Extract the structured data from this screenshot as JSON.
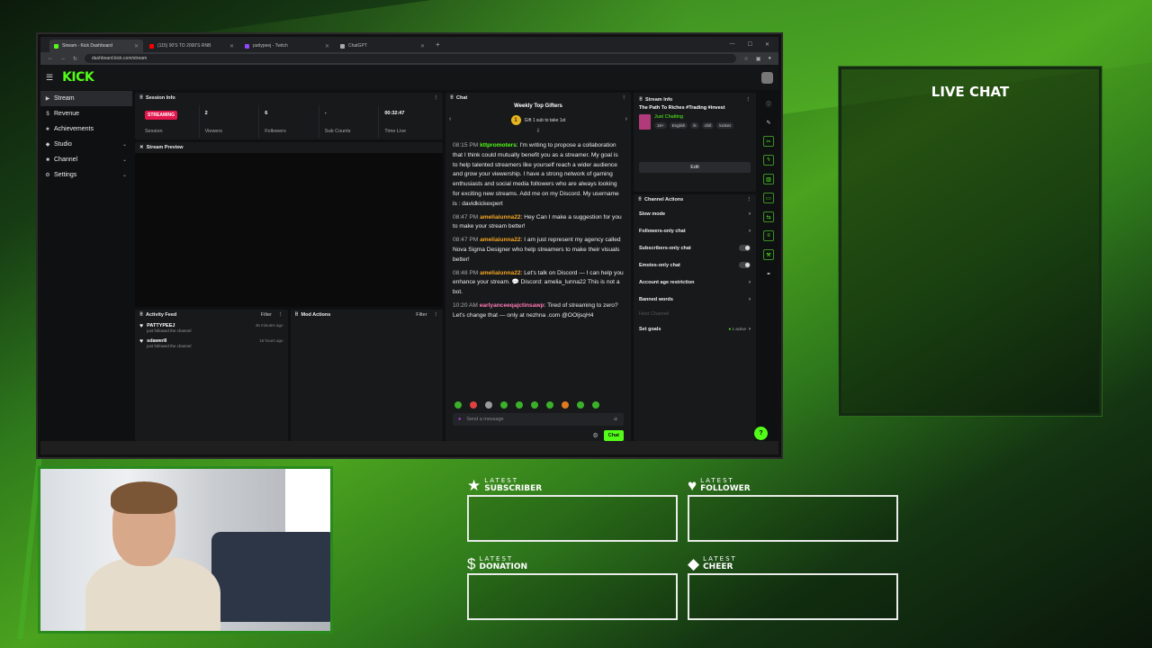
{
  "browser": {
    "tabs": [
      {
        "title": "Stream - Kick Dashboard",
        "color": "#53fc18",
        "active": true
      },
      {
        "title": "(115) 90'S TO 2000'S RNB",
        "color": "#ff0000",
        "active": false
      },
      {
        "title": "pattypeej - Twitch",
        "color": "#9146ff",
        "active": false
      },
      {
        "title": "ChatGPT",
        "color": "#aaaaaa",
        "active": false
      }
    ],
    "new_tab": "+",
    "url": "dashboard.kick.com/stream"
  },
  "kick": {
    "logo": "KICK",
    "sidebar": [
      {
        "label": "Stream",
        "icon": "▶",
        "active": true,
        "chevron": false
      },
      {
        "label": "Revenue",
        "icon": "$",
        "active": false,
        "chevron": false
      },
      {
        "label": "Achievements",
        "icon": "★",
        "active": false,
        "chevron": false
      },
      {
        "label": "Studio",
        "icon": "◆",
        "active": false,
        "chevron": true
      },
      {
        "label": "Channel",
        "icon": "■",
        "active": false,
        "chevron": true
      },
      {
        "label": "Settings",
        "icon": "⚙",
        "active": false,
        "chevron": true
      }
    ],
    "session": {
      "title": "Session Info",
      "badge": "STREAMING",
      "stats": [
        {
          "value": "",
          "label": "Session"
        },
        {
          "value": "2",
          "label": "Viewers"
        },
        {
          "value": "6",
          "label": "Followers"
        },
        {
          "value": "-",
          "label": "Sub Counts"
        },
        {
          "value": "00:32:47",
          "label": "Time Live"
        }
      ]
    },
    "preview": {
      "title": "Stream Preview"
    },
    "activity": {
      "title": "Activity Feed",
      "filter": "Filter",
      "items": [
        {
          "name": "PATTYPEEJ",
          "sub": "just followed the channel",
          "time": "46 minutes ago"
        },
        {
          "name": "sdawer8",
          "sub": "just followed the channel",
          "time": "15 hours ago"
        }
      ]
    },
    "mod": {
      "title": "Mod Actions",
      "filter": "Filter"
    },
    "chat": {
      "title": "Chat",
      "gifters_title": "Weekly Top Gifters",
      "gifters_rank": "1",
      "gifters_text": "Gift 1 sub to take 1st",
      "messages": [
        {
          "time": "08:15 PM",
          "user": "kttpromoters",
          "color": "#53fc18",
          "text": ": I'm writing to propose a collaboration that I think could mutually benefit you as a streamer. My goal is to help talented streamers like yourself reach a wider audience and grow your viewership. I have a strong network of gaming enthusiasts and social media followers who are always looking for exciting new streams. Add me on my Discord. My username is : davidkickexpert"
        },
        {
          "time": "08:47 PM",
          "user": "ameliaiunna22",
          "color": "#f5a623",
          "text": ": Hey Can I make a suggestion for you to make your stream better!"
        },
        {
          "time": "08:47 PM",
          "user": "ameliaiunna22",
          "color": "#f5a623",
          "text": ": I am just represent my agency called Nova Sigma Designer who help streamers to make their visuals better!"
        },
        {
          "time": "08:48 PM",
          "user": "ameliaiunna22",
          "color": "#f5a623",
          "text": ": Let's talk on Discord — I can help you enhance your stream. 💬 Discord: amelia_lunna22 This is not a bot."
        },
        {
          "time": "10:20 AM",
          "user": "earlyanceeqajctinsawp",
          "color": "#ff7ab8",
          "text": ": Tired of streaming to zero? Let's change that — only at nezhna .com @OOljsqH4"
        }
      ],
      "placeholder": "Send a message",
      "send_label": "Chat"
    },
    "stream_info": {
      "title": "Stream Info",
      "stream_title": "The Path To Riches #Trading #invest",
      "category": "Just Chatting",
      "tags": [
        "18+",
        "English",
        "lit",
        "chill",
        "kickstr"
      ],
      "edit_label": "Edit"
    },
    "channel_actions": {
      "title": "Channel Actions",
      "items": [
        {
          "label": "Slow mode",
          "kind": "arrow"
        },
        {
          "label": "Followers-only chat",
          "kind": "arrow"
        },
        {
          "label": "Subscribers-only chat",
          "kind": "toggle"
        },
        {
          "label": "Emotes-only chat",
          "kind": "toggle"
        },
        {
          "label": "Account age restriction",
          "kind": "arrow"
        },
        {
          "label": "Banned words",
          "kind": "arrow"
        },
        {
          "label": "Host Channel",
          "kind": "dim"
        },
        {
          "label": "Set goals",
          "kind": "goals",
          "status": "1 active"
        }
      ]
    }
  },
  "overlay": {
    "live_chat": "LIVE CHAT",
    "widgets": [
      {
        "small": "LATEST",
        "big": "SUBSCRIBER",
        "icon": "★",
        "icon_name": "star-icon"
      },
      {
        "small": "LATEST",
        "big": "FOLLOWER",
        "icon": "♥",
        "icon_name": "heart-icon"
      },
      {
        "small": "LATEST",
        "big": "DONATION",
        "icon": "$",
        "icon_name": "dollar-icon"
      },
      {
        "small": "LATEST",
        "big": "CHEER",
        "icon": "◆",
        "icon_name": "diamond-icon"
      }
    ]
  }
}
